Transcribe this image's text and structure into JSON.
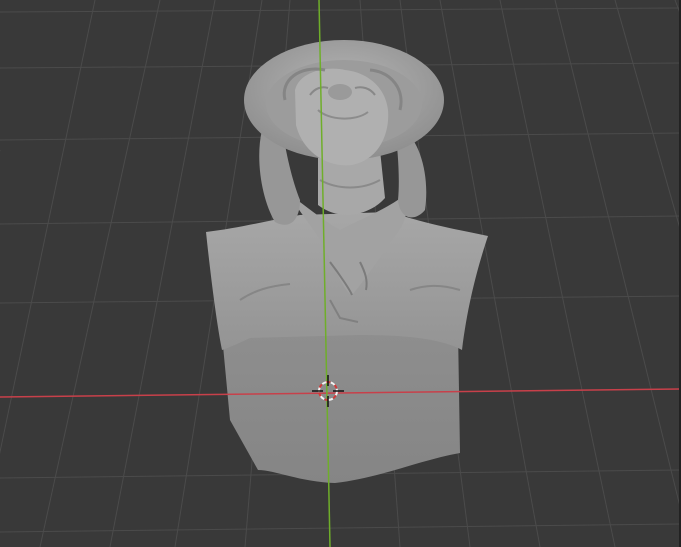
{
  "viewport": {
    "background_color": "#393939",
    "grid_color": "#4d4d4d",
    "x_axis_color": "#c8404a",
    "y_axis_color": "#6fae2a",
    "mesh_color": "#9a9a9a",
    "mesh_shadow_color": "#838383",
    "cursor_color_a": "#d23a3a",
    "cursor_color_b": "#f2f2f2"
  },
  "scene": {
    "object": "bust-mesh",
    "cursor": "3d-cursor-icon"
  }
}
